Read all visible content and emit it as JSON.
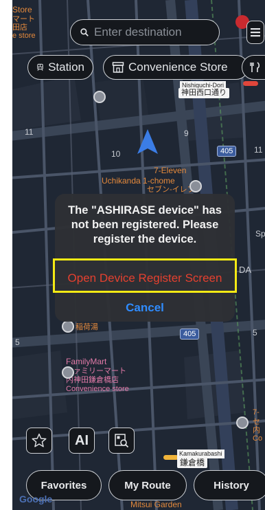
{
  "search": {
    "placeholder": "Enter destination"
  },
  "chips": [
    {
      "label": "Station"
    },
    {
      "label": "Convenience Store"
    }
  ],
  "map_labels": {
    "corner_store_top": "Store",
    "corner_store_mid1": "マート",
    "corner_store_mid2": "田店",
    "corner_store_bottom": "e store",
    "road_tag_upper": "神田西口通り",
    "road_tag_upper_en": "Nishiguchi-Dori",
    "num_11_left": "11",
    "num_10": "10",
    "num_9": "9",
    "route_405_upper": "405",
    "num_11_right": "11",
    "seven_eleven_en": "7-Eleven",
    "uchikanda": "Uchikanda 1-chome",
    "seven_eleven_jp": "セブン-イレブン",
    "sp_fragment": "Sp",
    "da_fragment": "DA",
    "inariyu": "稲荷湯",
    "route_405_lower": "405",
    "num_5_left": "5",
    "num_5_right": "5",
    "familymart_en": "FamilyMart",
    "familymart_jp1": "ファミリーマート",
    "familymart_jp2": "内神田鎌倉橋店",
    "familymart_cat": "Convenience store",
    "right_7": "7-",
    "right_se": "セ",
    "right_na": "内",
    "right_co": "Co",
    "kamakurabashi_en": "Kamakurabashi",
    "kamakurabashi_jp": "鎌倉橋",
    "mitsui": "Mitsui Garden"
  },
  "dialog": {
    "message": "The \"ASHIRASE device\" has not been registered. Please register the device.",
    "primary_label": "Open Device Register Screen",
    "cancel_label": "Cancel"
  },
  "tools": {
    "ai_label": "AI"
  },
  "tabs": [
    {
      "label": "Favorites"
    },
    {
      "label": "My Route"
    },
    {
      "label": "History"
    }
  ],
  "logo_text": "Google",
  "colors": {
    "map_bg": "#1f2734",
    "danger": "#e5402f",
    "link": "#2f8cff",
    "highlight": "#f5ea14"
  }
}
